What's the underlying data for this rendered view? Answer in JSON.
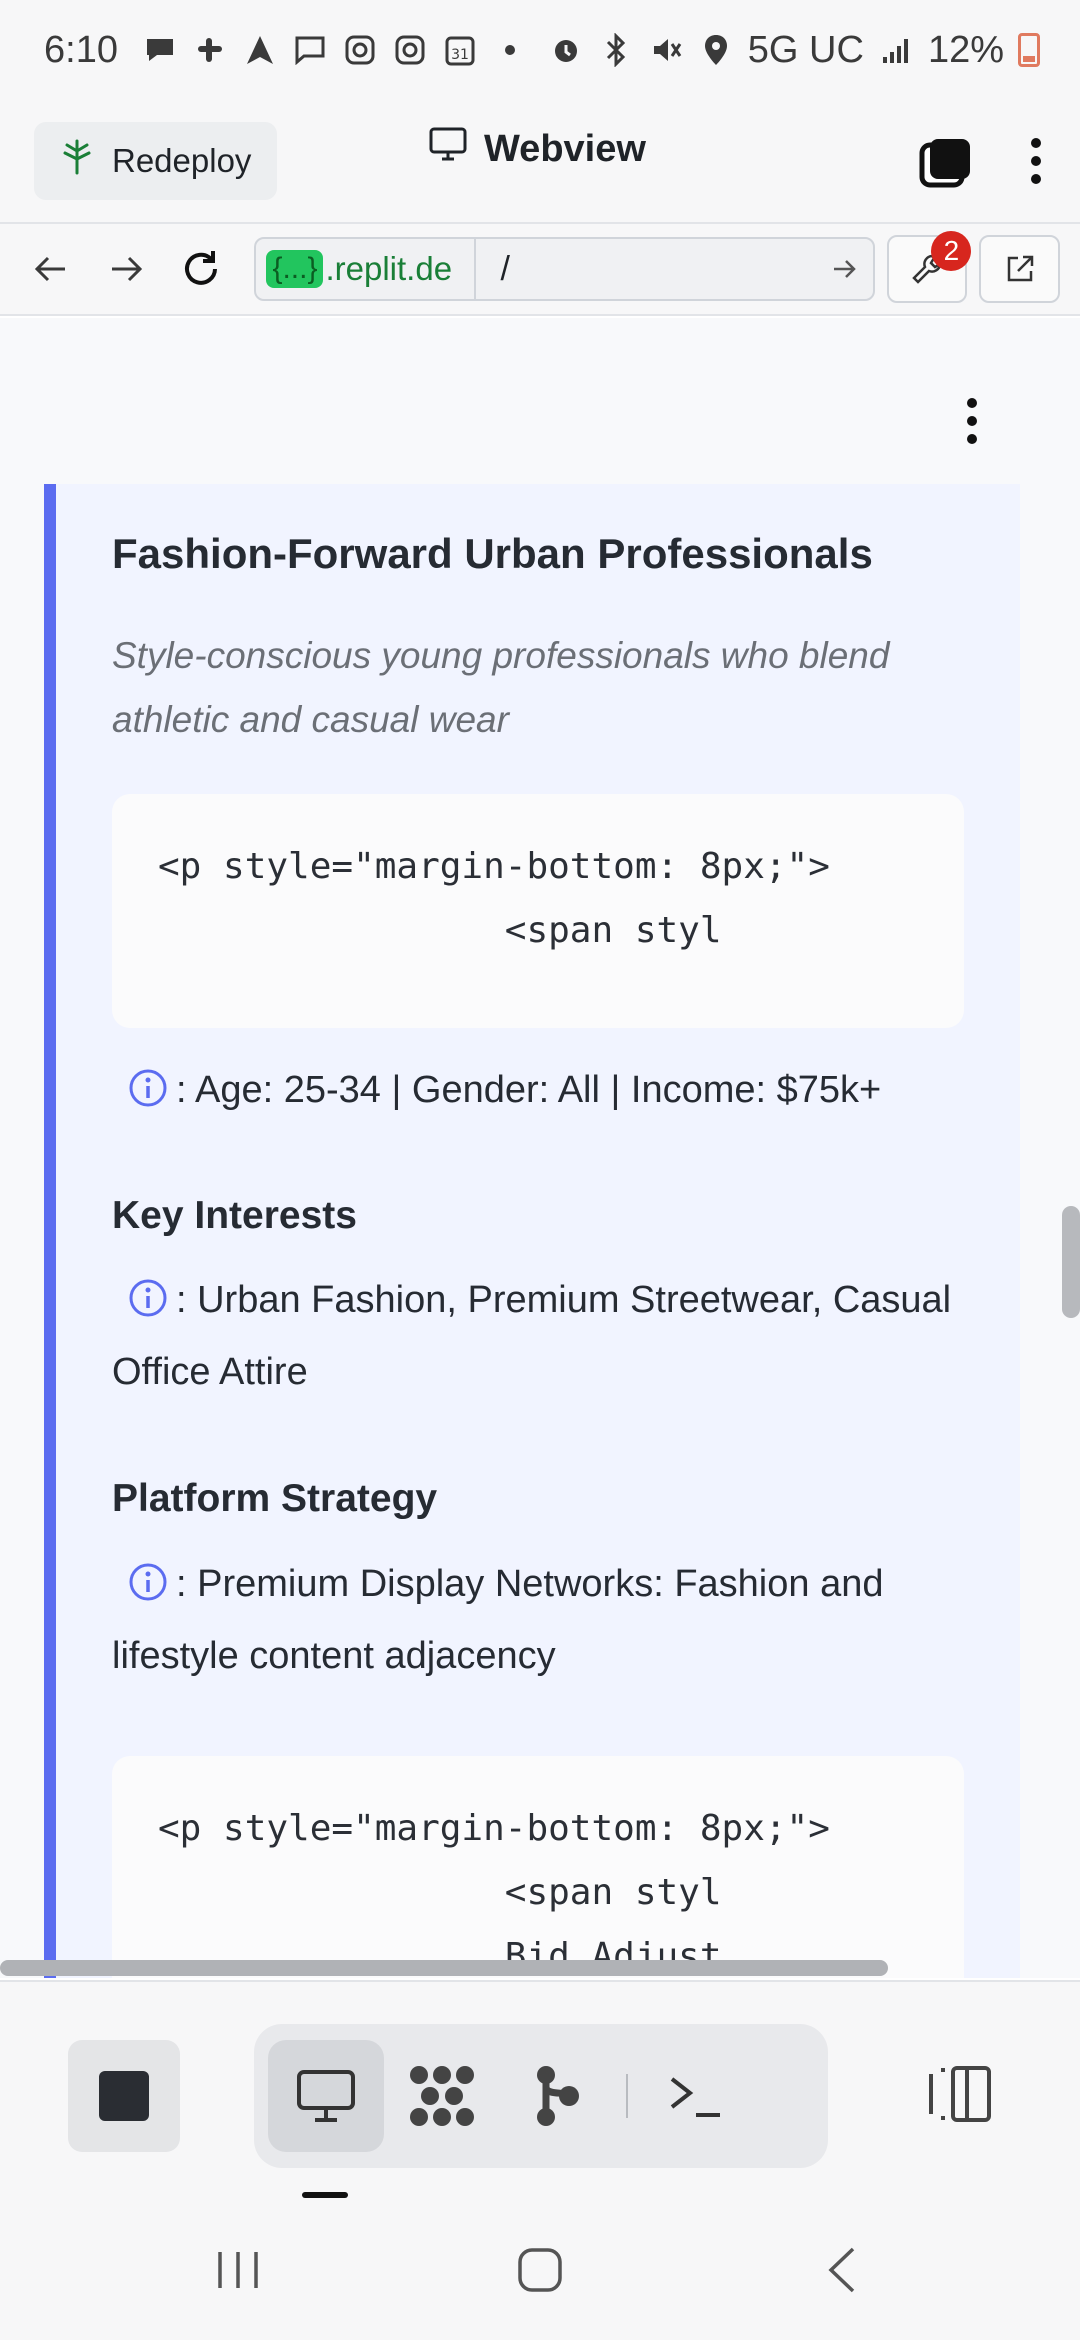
{
  "status_bar": {
    "time": "6:10",
    "network": "5G UC",
    "battery": "12%"
  },
  "header": {
    "redeploy_label": "Redeploy",
    "title": "Webview"
  },
  "url_bar": {
    "domain_badge": "{...}",
    "domain": ".replit.de",
    "path": "/",
    "tool_badge_count": "2"
  },
  "segment": {
    "title": "Fashion-Forward Urban Professionals",
    "description": "Style-conscious young professionals who blend athletic and casual wear",
    "code_block_1": {
      "line1": "<p style=\"margin-bottom: 8px;\">",
      "line2": "                <span styl"
    },
    "demographics": ": Age: 25-34 | Gender: All | Income: $75k+",
    "interests_heading": "Key Interests",
    "interests": ": Urban Fashion, Premium Streetwear, Casual Office Attire",
    "platform_heading": "Platform Strategy",
    "platform": ": Premium Display Networks: Fashion and lifestyle content adjacency",
    "code_block_2": {
      "line1": "<p style=\"margin-bottom: 8px;\">",
      "line2": "                <span styl",
      "line3": "                Bid Adjust"
    }
  },
  "colors": {
    "accent_bar": "#5b6cf0",
    "card_bg": "#f1f4ff",
    "info_icon": "#5b6cf0",
    "badge": "#d7261e",
    "domain_badge": "#22c55e"
  },
  "icons": {
    "redeploy": "tree-icon",
    "webview": "monitor-icon",
    "tabs": "stacked-squares-icon",
    "back": "arrow-left-icon",
    "forward": "arrow-right-icon",
    "reload": "reload-icon",
    "go": "arrow-right-icon",
    "devtools": "wrench-icon",
    "open_external": "external-link-icon",
    "stop": "stop-icon",
    "webview_tool": "monitor-icon",
    "workflows": "grid-dots-icon",
    "git": "git-branch-icon",
    "console": "terminal-icon",
    "panels": "panel-toggle-icon"
  }
}
